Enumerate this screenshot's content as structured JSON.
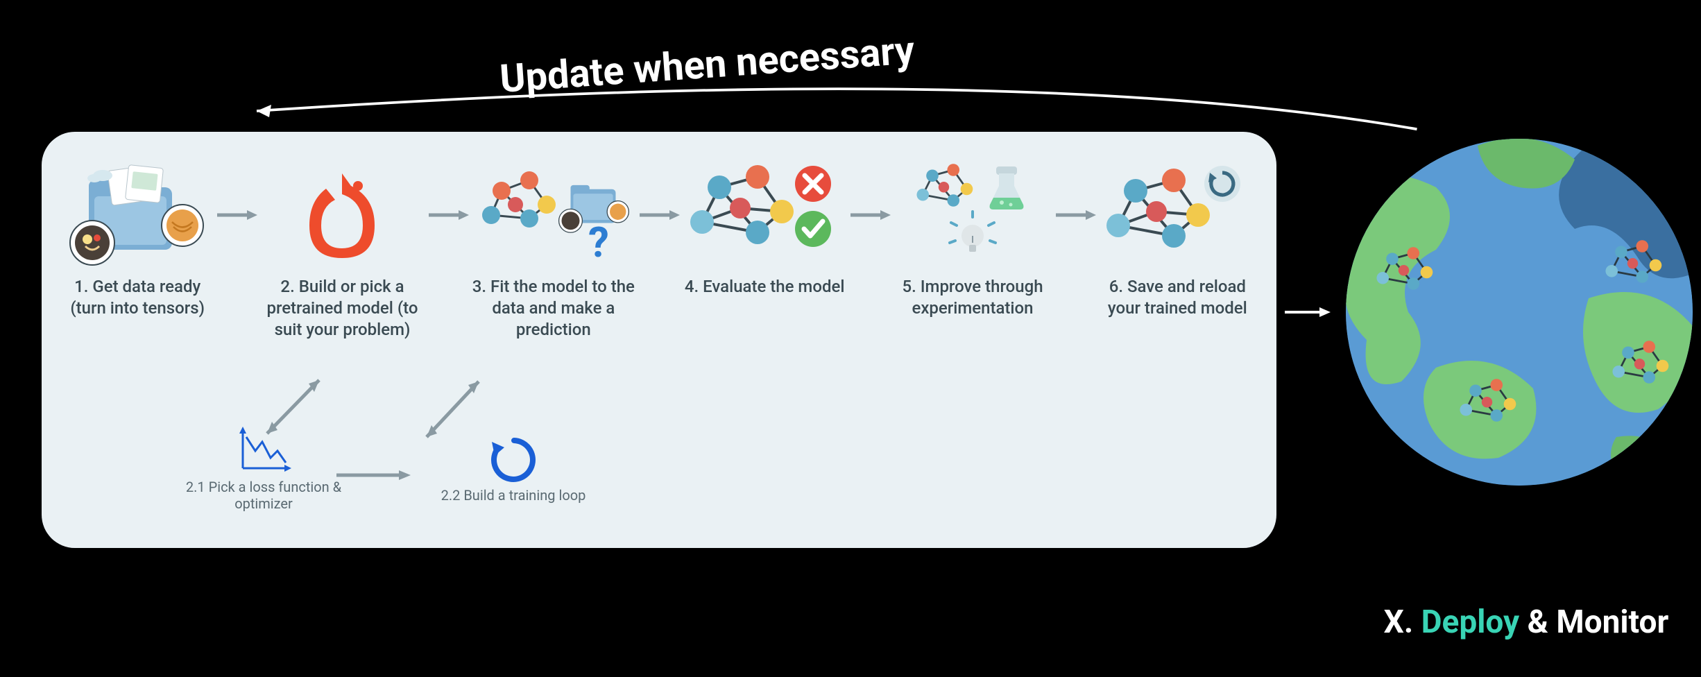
{
  "top_caption": "Update when necessary",
  "steps": {
    "s1": "1. Get data ready (turn into tensors)",
    "s2": "2. Build or pick a pretrained model (to suit your problem)",
    "s3": "3. Fit the model to the data and make a prediction",
    "s4": "4. Evaluate the model",
    "s5": "5. Improve through experimentation",
    "s6": "6. Save and reload your trained model",
    "s21": "2.1 Pick a loss function & optimizer",
    "s22": "2.2 Build a training loop"
  },
  "deploy": {
    "prefix": "X.",
    "word": "Deploy",
    "suffix": "& Monitor"
  },
  "colors": {
    "card_bg": "#eaf1f4",
    "text": "#3a4a52",
    "accent_teal": "#39d4b5",
    "pytorch_orange": "#ee4c2c",
    "arrow_grey": "#8a9aa2",
    "blue": "#1a5fd6",
    "green_ok": "#4caf50",
    "red_bad": "#e74c3c"
  }
}
